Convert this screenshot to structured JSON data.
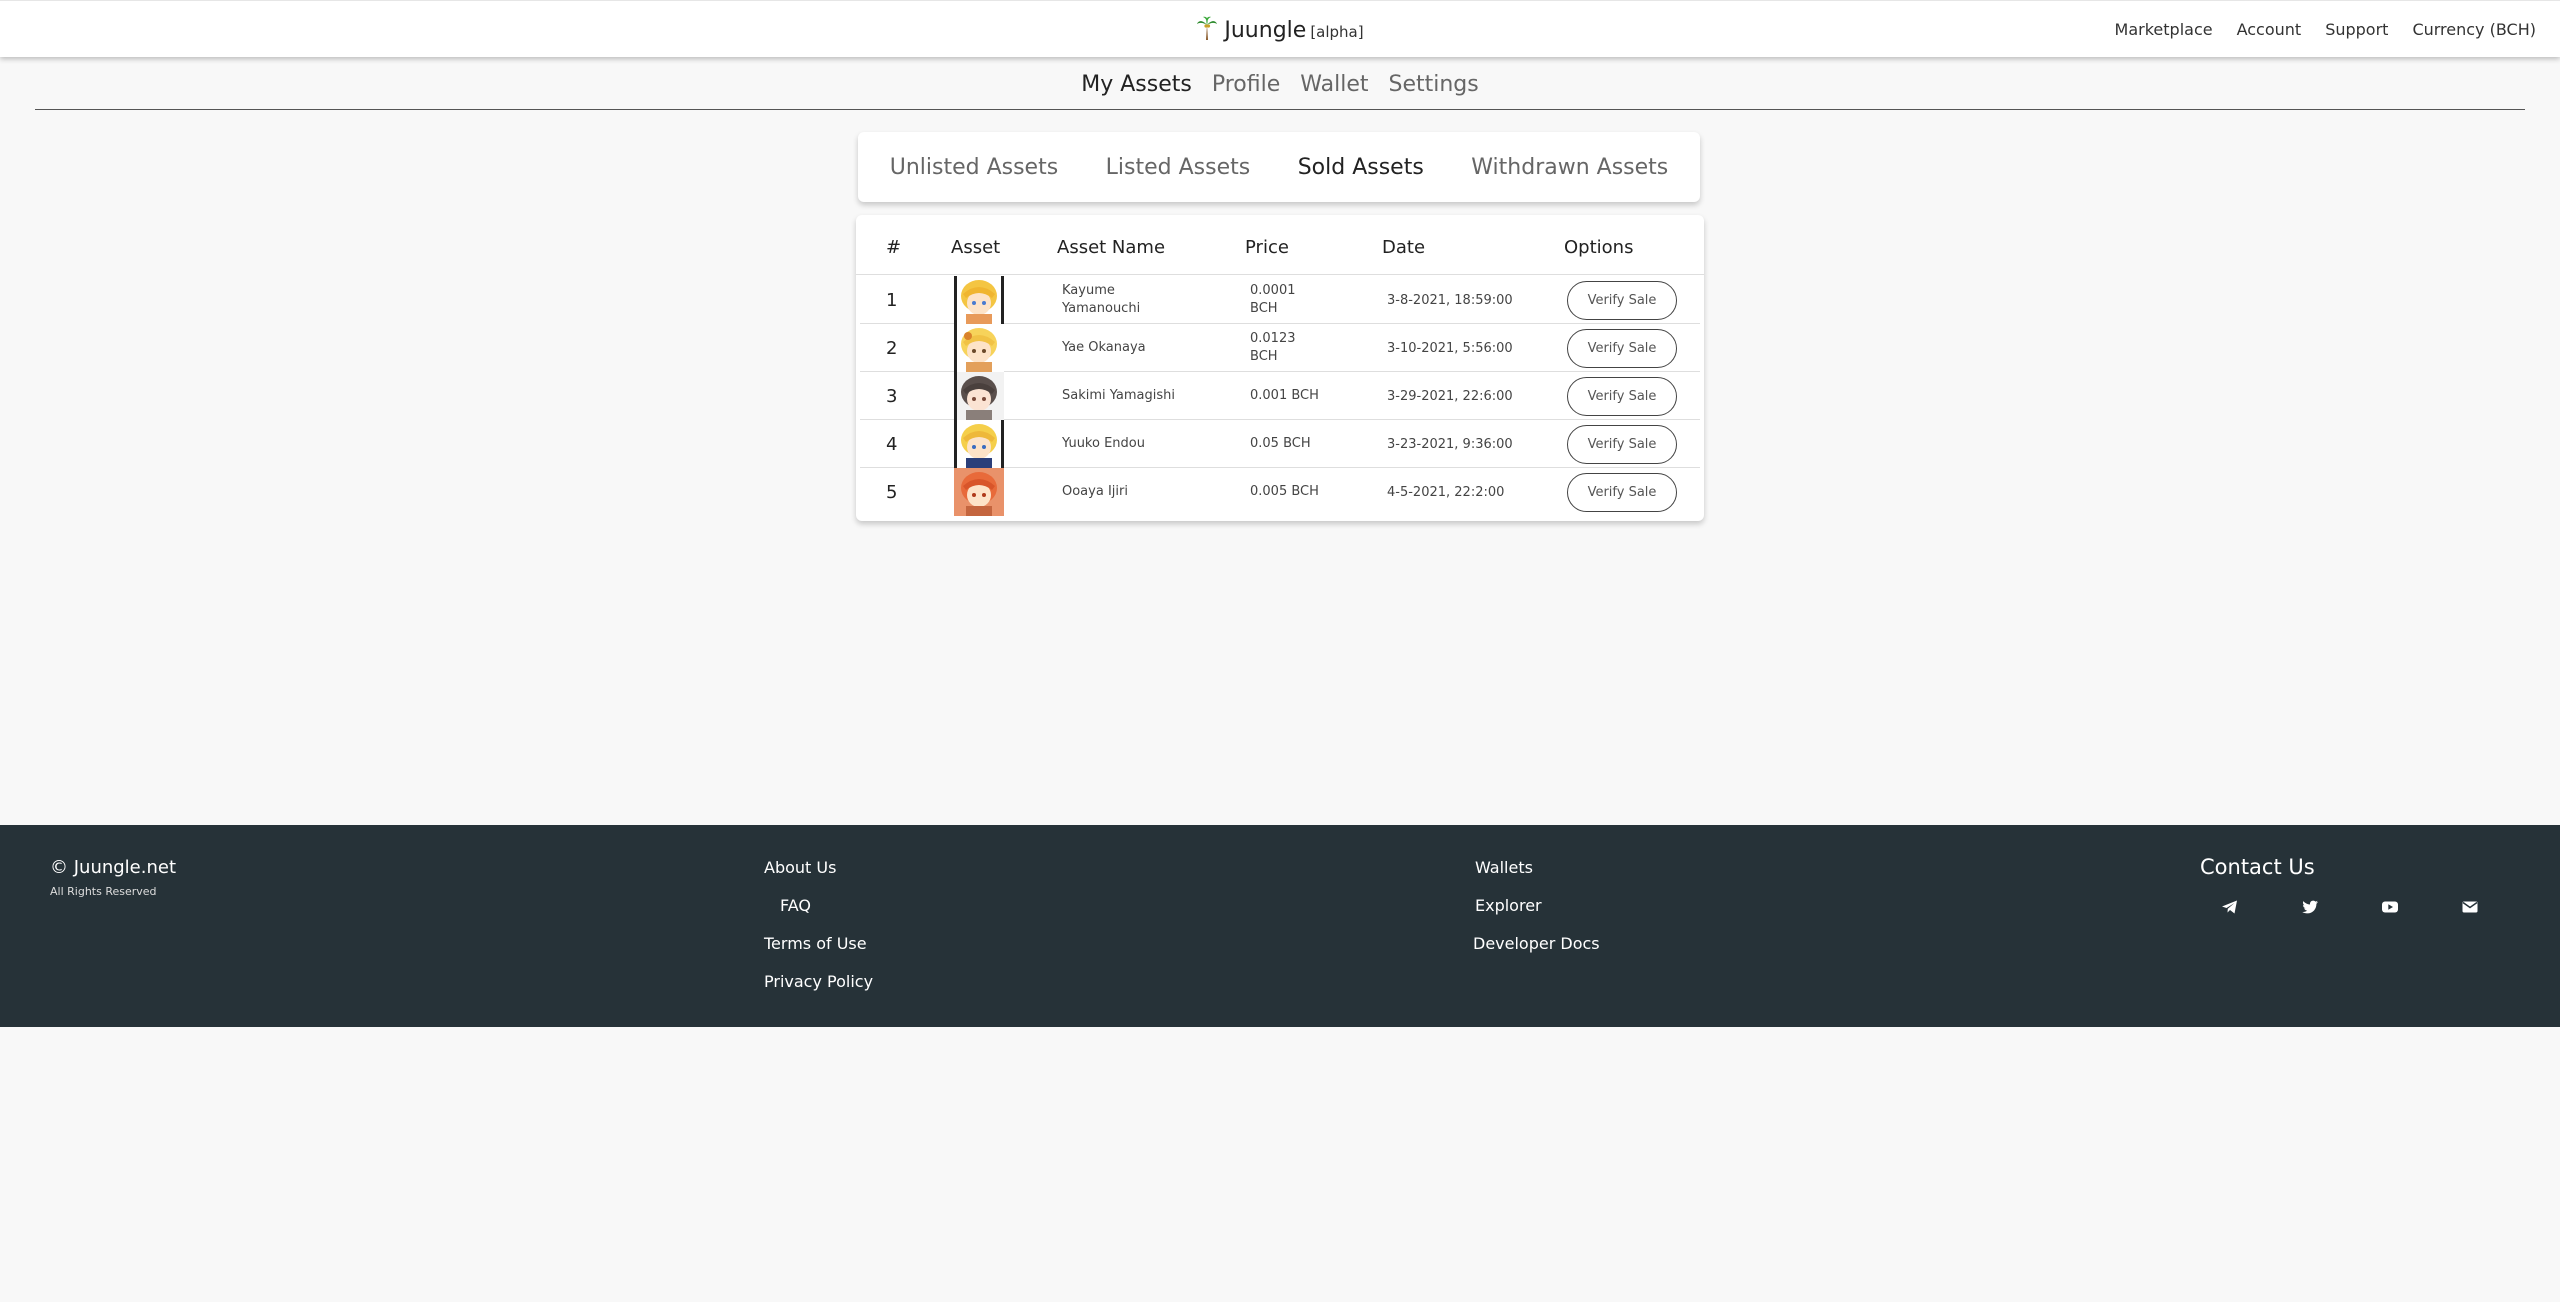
{
  "header": {
    "brand": "Juungle",
    "brand_tag": "[alpha]",
    "nav": [
      "Marketplace",
      "Account",
      "Support",
      "Currency (BCH)"
    ]
  },
  "subnav": {
    "items": [
      "My Assets",
      "Profile",
      "Wallet",
      "Settings"
    ],
    "active": "My Assets"
  },
  "tabs": {
    "items": [
      "Unlisted Assets",
      "Listed Assets",
      "Sold Assets",
      "Withdrawn Assets"
    ],
    "active": "Sold Assets"
  },
  "table": {
    "columns": [
      "#",
      "Asset",
      "Asset Name",
      "Price",
      "Date",
      "Options"
    ],
    "rows": [
      {
        "num": "1",
        "name": "Kayume Yamanouchi",
        "price": "0.0001 BCH",
        "date": "3-8-2021, 18:59:00",
        "action": "Verify Sale"
      },
      {
        "num": "2",
        "name": "Yae Okanaya",
        "price": "0.0123 BCH",
        "date": "3-10-2021, 5:56:00",
        "action": "Verify Sale"
      },
      {
        "num": "3",
        "name": "Sakimi Yamagishi",
        "price": "0.001 BCH",
        "date": "3-29-2021, 22:6:00",
        "action": "Verify Sale"
      },
      {
        "num": "4",
        "name": "Yuuko Endou",
        "price": "0.05 BCH",
        "date": "3-23-2021, 9:36:00",
        "action": "Verify Sale"
      },
      {
        "num": "5",
        "name": "Ooaya Ijiri",
        "price": "0.005 BCH",
        "date": "4-5-2021, 22:2:00",
        "action": "Verify Sale"
      }
    ]
  },
  "footer": {
    "copyright": "© Juungle.net",
    "rights": "All Rights Reserved",
    "col1": [
      "About Us",
      "FAQ",
      "Terms of Use",
      "Privacy Policy"
    ],
    "col2": [
      "Wallets",
      "Explorer",
      "Developer Docs"
    ],
    "contact_title": "Contact Us",
    "icons": [
      "telegram-icon",
      "twitter-icon",
      "youtube-icon",
      "email-icon"
    ]
  },
  "colors": {
    "footer_bg": "#263238",
    "page_bg": "#f8f8f8"
  }
}
